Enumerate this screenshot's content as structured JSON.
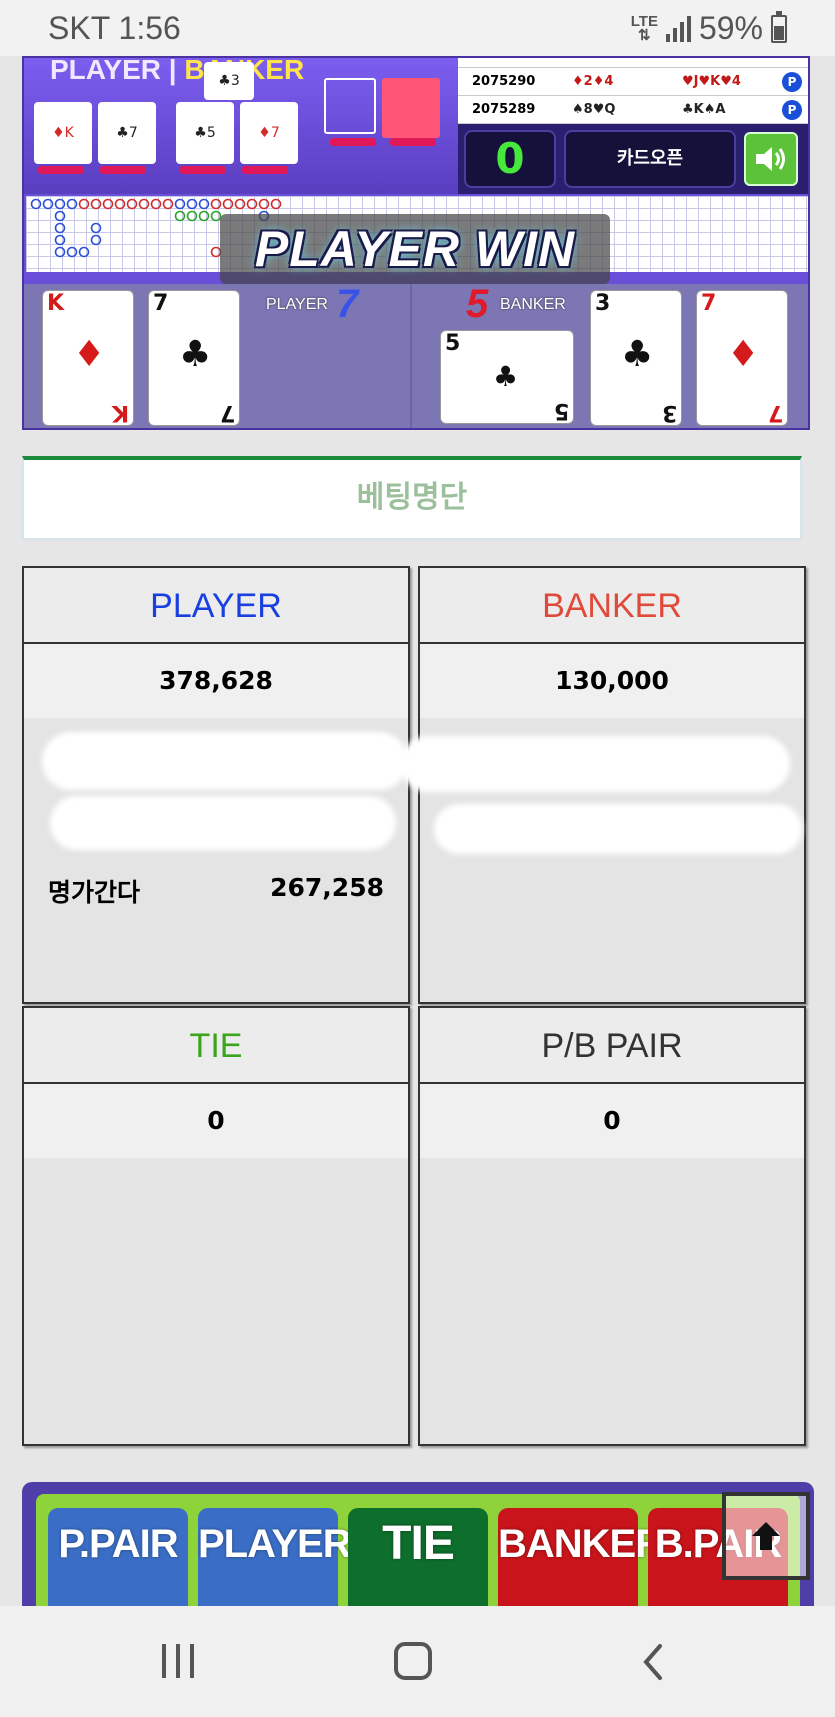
{
  "status_bar": {
    "carrier_time": "SKT 1:56",
    "network": "LTE",
    "battery": "59%"
  },
  "game": {
    "scene_title_player": "PLAYER",
    "scene_title_banker": "BANKER",
    "history": [
      {
        "id": "2075290",
        "player_cards": "♦2♦4",
        "banker_cards": "♥J♥K♥4",
        "result": "P"
      },
      {
        "id": "2075289",
        "player_cards": "♠8♥Q",
        "banker_cards": "♣K♠A",
        "result": "P"
      }
    ],
    "counter": "0",
    "card_open_label": "카드오픈",
    "win_banner": "PLAYER WIN",
    "player_label": "PLAYER",
    "player_score": "7",
    "banker_label": "BANKER",
    "banker_score": "5",
    "player_cards": [
      {
        "rank": "K",
        "suit": "♦",
        "color": "red"
      },
      {
        "rank": "7",
        "suit": "♣",
        "color": "black"
      }
    ],
    "banker_cards": [
      {
        "rank": "5",
        "suit": "♣",
        "color": "black"
      },
      {
        "rank": "3",
        "suit": "♣",
        "color": "black"
      },
      {
        "rank": "7",
        "suit": "♦",
        "color": "red"
      }
    ]
  },
  "bet_list": {
    "title": "베팅명단",
    "player": {
      "label": "PLAYER",
      "total": "378,628",
      "color": "#1a3fe0",
      "entries": [
        {
          "name": "명가간다",
          "amount": "267,258"
        }
      ]
    },
    "banker": {
      "label": "BANKER",
      "total": "130,000",
      "color": "#e04a3a"
    },
    "tie": {
      "label": "TIE",
      "total": "0",
      "color": "#3aa41a"
    },
    "pair": {
      "label": "P/B PAIR",
      "total": "0",
      "color": "#333333"
    }
  },
  "bet_buttons": {
    "p_pair": "P.PAIR",
    "player": "PLAYER",
    "tie": "TIE",
    "banker": "BANKER",
    "b_pair": "B.PAIR"
  },
  "icons": {
    "scroll_top": "arrow-up-icon",
    "sound": "speaker-icon"
  }
}
